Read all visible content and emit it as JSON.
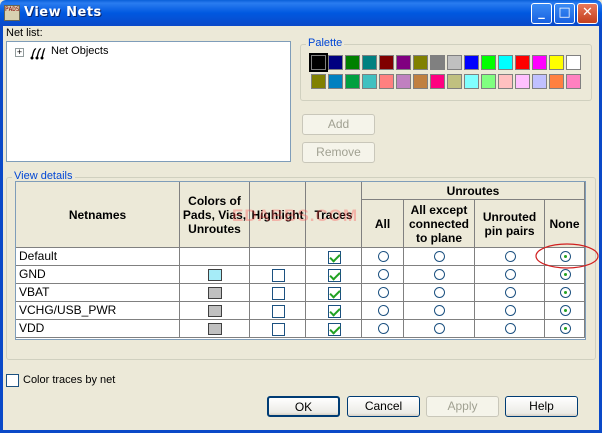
{
  "window": {
    "title": "View Nets",
    "app_icon_text": "PADS"
  },
  "netlist": {
    "label": "Net list:",
    "root_item": "Net Objects"
  },
  "palette": {
    "label": "Palette",
    "row1": [
      "#000000",
      "#000080",
      "#008000",
      "#008080",
      "#800000",
      "#800080",
      "#808000",
      "#808080",
      "#c0c0c0",
      "#0000ff",
      "#00ff00",
      "#00ffff",
      "#ff0000",
      "#ff00ff",
      "#ffff00",
      "#ffffff"
    ],
    "row2": [
      "#808000",
      "#0080c0",
      "#00a040",
      "#40c0c0",
      "#ff8080",
      "#c080c0",
      "#c08040",
      "#ff0080",
      "#c0c080",
      "#80ffff",
      "#80ff80",
      "#ffc0c0",
      "#ffc0ff",
      "#c0c0ff",
      "#ff8040",
      "#ff80c0"
    ]
  },
  "buttons": {
    "add": "Add",
    "remove": "Remove",
    "ok": "OK",
    "cancel": "Cancel",
    "apply": "Apply",
    "help": "Help"
  },
  "view_details": {
    "label": "View details",
    "headers": {
      "netnames": "Netnames",
      "colors": "Colors of Pads, Vias, Unroutes",
      "highlight": "Highlight",
      "traces": "Traces",
      "unroutes": "Unroutes",
      "all": "All",
      "all_except": "All except connected to plane",
      "unrouted_pairs": "Unrouted pin pairs",
      "none": "None"
    },
    "rows": [
      {
        "name": "Default",
        "color": "",
        "highlight": null,
        "traces": true,
        "unroutes": "none"
      },
      {
        "name": "GND",
        "color": "#a6ecf8",
        "highlight": false,
        "traces": true,
        "unroutes": "none"
      },
      {
        "name": "VBAT",
        "color": "#c0c0c0",
        "highlight": false,
        "traces": true,
        "unroutes": "none"
      },
      {
        "name": "VCHG/USB_PWR",
        "color": "#c0c0c0",
        "highlight": false,
        "traces": true,
        "unroutes": "none"
      },
      {
        "name": "VDD",
        "color": "#c0c0c0",
        "highlight": false,
        "traces": true,
        "unroutes": "none"
      }
    ]
  },
  "color_traces": {
    "label": "Color traces by net",
    "checked": false
  },
  "watermark": "EDABBS.COM"
}
